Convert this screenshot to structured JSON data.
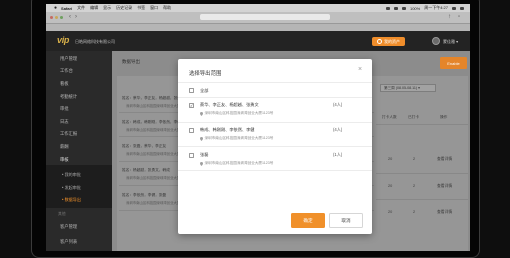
{
  "menubar": {
    "app": "Safari",
    "items": [
      "文件",
      "编辑",
      "显示",
      "历史记录",
      "书签",
      "窗口",
      "帮助"
    ],
    "battery": "100%",
    "clock": "周一下午4:27"
  },
  "header": {
    "logo": "vip",
    "company": "日皓网络科技有限公司",
    "assets_button": "我的资产",
    "user_name": "蒙佳雅"
  },
  "sidebar": {
    "items": [
      "用户管理",
      "工作台",
      "看板",
      "考勤统计",
      "审批",
      "日志",
      "工作汇报",
      "薪酬",
      "审核"
    ],
    "subitems": [
      "我的审批",
      "发起审批",
      "数据导出"
    ],
    "active_subitem": "数据导出",
    "section_label": "其他",
    "extra_items": [
      "客户管理",
      "客户列表"
    ]
  },
  "main": {
    "title": "数据导出",
    "action_button": "Enable",
    "records": [
      {
        "names": "姓名：蔡华，李正友，杨超越，张勇文",
        "address": "深圳市南山区科技园深圳湾创业大厦1123号"
      },
      {
        "names": "姓名：韩成，韩刚刚，李依然，李健",
        "address": "深圳市南山区科技园深圳湾创业大厦1123号"
      },
      {
        "names": "姓名：张磊，蔡华，李正友",
        "address": "深圳市南山区科技园深圳湾创业大厦1123号"
      },
      {
        "names": "姓名：杨超越，张勇文，韩成",
        "address": "深圳市南山区科技园深圳湾创业大厦1123号"
      },
      {
        "names": "姓名：李依然，李健，张磊",
        "address": "深圳市南山区科技园深圳湾创业大厦1123号"
      }
    ],
    "week_select": "第三周 (08.05-08.11)",
    "columns": [
      "打卡人数",
      "已打卡",
      "操作"
    ],
    "rows": [
      {
        "count": "20",
        "checked": "2",
        "action": "查看详情"
      },
      {
        "count": "20",
        "checked": "2",
        "action": "查看详情"
      },
      {
        "count": "20",
        "checked": "2",
        "action": "查看详情"
      }
    ]
  },
  "modal": {
    "title": "选择导出范围",
    "close": "×",
    "options": [
      {
        "label": "全部",
        "checked": false
      },
      {
        "label": "蔡华、李正友、杨超越、张勇文",
        "count": "(4人)",
        "address": "深圳市南山区科技园深圳湾创业大厦1123号",
        "checked": true
      },
      {
        "label": "韩成、韩刚刚、李依然、李健",
        "count": "(4人)",
        "address": "深圳市南山区科技园深圳湾创业大厦1123号",
        "checked": false
      },
      {
        "label": "张磊",
        "count": "(1人)",
        "address": "深圳市南山区科技园深圳湾创业大厦1123号",
        "checked": false
      }
    ],
    "confirm": "确定",
    "cancel": "取消"
  },
  "colors": {
    "accent": "#f0902a",
    "header_bg": "#232323",
    "sidebar_bg": "#2a2a2a"
  }
}
